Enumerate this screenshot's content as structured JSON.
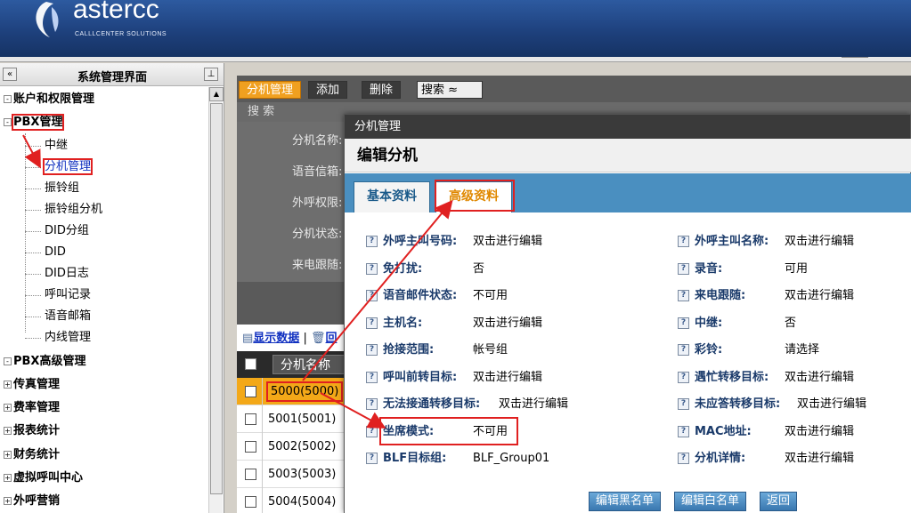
{
  "header": {
    "logo_text": "astercc",
    "logo_sub": "CALLLCENTER SOLUTIONS"
  },
  "sidebar": {
    "title": "系统管理界面",
    "collapse_glyph": "«",
    "pin_glyph": "⊥",
    "nodes": [
      {
        "label": "账户和权限管理",
        "state": "-"
      },
      {
        "label": "PBX管理",
        "state": "-"
      },
      {
        "label": "PBX高级管理",
        "state": "-"
      },
      {
        "label": "传真管理",
        "state": "+"
      },
      {
        "label": "费率管理",
        "state": "+"
      },
      {
        "label": "报表统计",
        "state": "+"
      },
      {
        "label": "财务统计",
        "state": "+"
      },
      {
        "label": "虚拟呼叫中心",
        "state": "+"
      },
      {
        "label": "外呼营销",
        "state": "+"
      }
    ],
    "pbx_children": [
      "中继",
      "分机管理",
      "振铃组",
      "振铃组分机",
      "DID分组",
      "DID",
      "DID日志",
      "呼叫记录",
      "语音邮箱",
      "内线管理"
    ]
  },
  "toolbar": {
    "tab_ext": "分机管理",
    "add": "添加",
    "delete": "删除",
    "search": "搜索",
    "search_toggle": "≈"
  },
  "search_panel": {
    "title": "搜 索",
    "labels": [
      "分机名称:",
      "语音信箱:",
      "外呼权限:",
      "分机状态:",
      "来电跟随:"
    ]
  },
  "data_panel": {
    "show_data": "显示数据",
    "sep": "|",
    "second": "回",
    "col_name": "分机名称",
    "rows": [
      "5000(5000)",
      "5001(5001)",
      "5002(5002)",
      "5003(5003)",
      "5004(5004)"
    ]
  },
  "modal": {
    "window_title": "分机管理",
    "heading": "编辑分机",
    "tab_basic": "基本资料",
    "tab_advanced": "高级资料",
    "left_fields": [
      {
        "label": "外呼主叫号码:",
        "value": "双击进行编辑"
      },
      {
        "label": "免打扰:",
        "value": "否"
      },
      {
        "label": "语音邮件状态:",
        "value": "不可用"
      },
      {
        "label": "主机名:",
        "value": "双击进行编辑"
      },
      {
        "label": "抢接范围:",
        "value": "帐号组"
      },
      {
        "label": "呼叫前转目标:",
        "value": "双击进行编辑"
      },
      {
        "label": "无法接通转移目标:",
        "value": "双击进行编辑"
      },
      {
        "label": "坐席模式:",
        "value": "不可用"
      },
      {
        "label": "BLF目标组:",
        "value": "BLF_Group01"
      }
    ],
    "right_fields": [
      {
        "label": "外呼主叫名称:",
        "value": "双击进行编辑"
      },
      {
        "label": "录音:",
        "value": "可用"
      },
      {
        "label": "来电跟随:",
        "value": "双击进行编辑"
      },
      {
        "label": "中继:",
        "value": "否"
      },
      {
        "label": "彩铃:",
        "value": "请选择"
      },
      {
        "label": "遇忙转移目标:",
        "value": "双击进行编辑"
      },
      {
        "label": "未应答转移目标:",
        "value": "双击进行编辑"
      },
      {
        "label": "MAC地址:",
        "value": "双击进行编辑"
      },
      {
        "label": "分机详情:",
        "value": "双击进行编辑"
      }
    ],
    "buttons": [
      "编辑黑名单",
      "编辑白名单",
      "返回"
    ]
  },
  "colors": {
    "accent_orange": "#f0a020",
    "tab_blue": "#4a8fc0",
    "annotation_red": "#e02020"
  }
}
